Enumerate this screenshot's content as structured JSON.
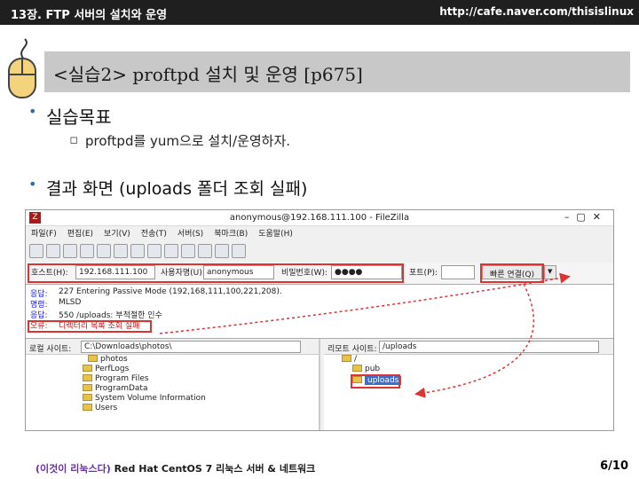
{
  "header": {
    "chapter": "13장. FTP 서버의 설치와 운영",
    "url": "http://cafe.naver.com/thisislinux"
  },
  "title": "<실습2> proftpd 설치 및 운영 [p675]",
  "bullets": {
    "goal": "실습목표",
    "goal_sub": "proftpd를 yum으로 설치/운영하자.",
    "result": "결과 화면 (uploads 폴더 조회 실패)"
  },
  "filezilla": {
    "window_title": "anonymous@192.168.111.100 - FileZilla",
    "menu": [
      "파일(F)",
      "편집(E)",
      "보기(V)",
      "전송(T)",
      "서버(S)",
      "북마크(B)",
      "도움말(H)"
    ],
    "host_label": "호스트(H):",
    "host_value": "192.168.111.100",
    "user_label": "사용자명(U):",
    "user_value": "anonymous",
    "pass_label": "비밀번호(W):",
    "pass_value": "●●●●",
    "port_label": "포트(P):",
    "port_value": "",
    "connect_label": "빠른 연결(Q)",
    "log": [
      {
        "k": "응답:",
        "v": "227 Entering Passive Mode (192,168,111,100,221,208)."
      },
      {
        "k": "명령:",
        "v": "MLSD"
      },
      {
        "k": "응답:",
        "v": "550 /uploads: 부적절한 인수"
      },
      {
        "k": "오류:",
        "v": "디렉터리 목록 조회 실패"
      }
    ],
    "local_label": "로컬 사이트:",
    "local_path": "C:\\Downloads\\photos\\",
    "local_items": [
      "photos",
      "PerfLogs",
      "Program Files",
      "ProgramData",
      "System Volume Information",
      "Users"
    ],
    "remote_label": "리모트 사이트:",
    "remote_path": "/uploads",
    "remote_root": "/",
    "remote_items": [
      "pub",
      "uploads"
    ]
  },
  "footer": {
    "book_prefix": "(이것이 리눅스다)",
    "book_rest": "Red Hat CentOS 7 리눅스 서버 & 네트워크",
    "page": "6/10"
  }
}
